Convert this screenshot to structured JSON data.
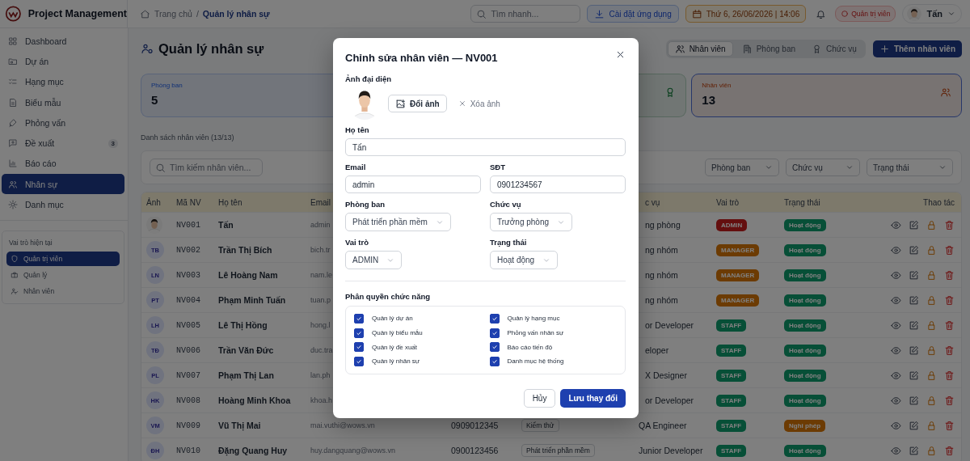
{
  "app": {
    "title": "Project Management"
  },
  "breadcrumb": {
    "separator": "/",
    "items": [
      {
        "label": "Trang chủ",
        "selected": false
      },
      {
        "label": "Quản lý nhân sự",
        "selected": true
      }
    ]
  },
  "topbar": {
    "search": {
      "placeholder": "Tìm nhanh..."
    },
    "install_button": "Cài đặt ứng dụng",
    "date": "Thứ 6, 26/06/2026 | 14:06",
    "role_badge": "Quản trị viên",
    "user": "Tấn"
  },
  "sidebar": {
    "items": [
      {
        "label": "Dashboard",
        "selected": false
      },
      {
        "label": "Dự án",
        "selected": false
      },
      {
        "label": "Hạng mục",
        "selected": false
      },
      {
        "label": "Biểu mẫu",
        "selected": false
      },
      {
        "label": "Phỏng vấn",
        "selected": false
      },
      {
        "label": "Đề xuất",
        "selected": false,
        "badge": "3"
      },
      {
        "label": "Báo cáo",
        "selected": false
      },
      {
        "label": "Nhân sự",
        "selected": true
      },
      {
        "label": "Danh mục",
        "selected": false
      }
    ],
    "role_section": {
      "title": "Vai trò hiện tại",
      "roles": [
        {
          "label": "Quản trị viên",
          "selected": true
        },
        {
          "label": "Quản lý",
          "selected": false
        },
        {
          "label": "Nhân viên",
          "selected": false
        }
      ]
    }
  },
  "page": {
    "title": "Quản lý nhân sự",
    "tabs": [
      {
        "label": "Nhân viên",
        "selected": true
      },
      {
        "label": "Phòng ban",
        "selected": false
      },
      {
        "label": "Chức vụ",
        "selected": false
      }
    ],
    "add_button": "Thêm nhân viên"
  },
  "stats": [
    {
      "label": "Phòng ban",
      "value": "5",
      "selected": false
    },
    {
      "selected": false
    },
    {
      "label": "Nhân viên",
      "value": "13",
      "selected": true
    }
  ],
  "list_title": "Danh sách nhân viên (13/13)",
  "filters": {
    "search": {
      "placeholder": "Tìm kiếm nhân viên..."
    },
    "selects": [
      "Phòng ban",
      "Chức vụ",
      "Trạng thái"
    ]
  },
  "table": {
    "columns": [
      "Ảnh",
      "Mã NV",
      "Họ tên",
      "Email",
      "c vụ",
      "Vai trò",
      "Trạng thái",
      "Thao tác"
    ],
    "rows": [
      {
        "id": "NV001",
        "name": "Tấn",
        "email": "admin",
        "position": "ng phòng",
        "role": {
          "label": "ADMIN",
          "kind": "admin"
        },
        "status": {
          "label": "Hoạt động",
          "kind": "active"
        }
      },
      {
        "avatar": {
          "kind": "initials",
          "text": "TB"
        },
        "id": "NV002",
        "name": "Trần Thị Bích",
        "email": "bich.tr",
        "position": "ng nhóm",
        "role": {
          "label": "MANAGER",
          "kind": "manager"
        },
        "status": {
          "label": "Hoạt động",
          "kind": "active"
        }
      },
      {
        "avatar": {
          "kind": "initials",
          "text": "LN"
        },
        "id": "NV003",
        "name": "Lê Hoàng Nam",
        "email": "nam.le",
        "position": "ng nhóm",
        "role": {
          "label": "MANAGER",
          "kind": "manager"
        },
        "status": {
          "label": "Hoạt động",
          "kind": "active"
        }
      },
      {
        "avatar": {
          "kind": "initials",
          "text": "PT"
        },
        "id": "NV004",
        "name": "Phạm Minh Tuấn",
        "email": "tuan.p",
        "position": "ng nhóm",
        "role": {
          "label": "MANAGER",
          "kind": "manager"
        },
        "status": {
          "label": "Hoạt động",
          "kind": "active"
        }
      },
      {
        "avatar": {
          "kind": "initials",
          "text": "LH"
        },
        "id": "NV005",
        "name": "Lê Thị Hồng",
        "email": "hong.l",
        "position": "or Developer",
        "role": {
          "label": "STAFF",
          "kind": "staff"
        },
        "status": {
          "label": "Hoạt động",
          "kind": "active"
        }
      },
      {
        "avatar": {
          "kind": "initials",
          "text": "TĐ"
        },
        "id": "NV006",
        "name": "Trần Văn Đức",
        "email": "duc.tra",
        "position": "eloper",
        "role": {
          "label": "STAFF",
          "kind": "staff"
        },
        "status": {
          "label": "Hoạt động",
          "kind": "active"
        }
      },
      {
        "avatar": {
          "kind": "initials",
          "text": "PL"
        },
        "id": "NV007",
        "name": "Phạm Thị Lan",
        "email": "lan.ph",
        "position": "X Designer",
        "role": {
          "label": "STAFF",
          "kind": "staff"
        },
        "status": {
          "label": "Hoạt động",
          "kind": "active"
        }
      },
      {
        "avatar": {
          "kind": "initials",
          "text": "HK"
        },
        "id": "NV008",
        "name": "Hoàng Minh Khoa",
        "email": "khoa.h",
        "position": "or Developer",
        "role": {
          "label": "STAFF",
          "kind": "staff"
        },
        "status": {
          "label": "Hoạt động",
          "kind": "active"
        }
      },
      {
        "avatar": {
          "kind": "initials",
          "text": "VM"
        },
        "id": "NV009",
        "name": "Vũ Thị Mai",
        "email": "mai.vuthi@wows.vn",
        "phone": "0909012345",
        "department": "Kiểm thử",
        "position": "QA Engineer",
        "role": {
          "label": "STAFF",
          "kind": "staff"
        },
        "status": {
          "label": "Nghỉ phép",
          "kind": "leave"
        }
      },
      {
        "avatar": {
          "kind": "initials",
          "text": "ĐH"
        },
        "id": "NV010",
        "name": "Đặng Quang Huy",
        "email": "huy.dangquang@wows.vn",
        "phone": "0900123456",
        "department": "Phát triển phần mềm",
        "position": "Junior Developer",
        "role": {
          "label": "STAFF",
          "kind": "staff"
        },
        "status": {
          "label": "Hoạt động",
          "kind": "active"
        }
      }
    ]
  },
  "modal": {
    "title": "Chỉnh sửa nhân viên — NV001",
    "avatar_label": "Ảnh đại diện",
    "change_photo": "Đổi ảnh",
    "remove_photo": "Xóa ảnh",
    "fields": [
      {
        "label": "Họ tên",
        "value": "Tấn",
        "kind": "text",
        "full_width": true
      },
      {
        "label": "Email",
        "value": "admin",
        "kind": "text",
        "full_width": false
      },
      {
        "label": "SĐT",
        "value": "0901234567",
        "kind": "text",
        "full_width": false
      },
      {
        "label": "Phòng ban",
        "value": "Phát triển phần mềm",
        "kind": "select",
        "full_width": false
      },
      {
        "label": "Chức vụ",
        "value": "Trưởng phòng",
        "kind": "select",
        "full_width": false
      },
      {
        "label": "Vai trò",
        "value": "ADMIN",
        "kind": "select",
        "full_width": false
      },
      {
        "label": "Trạng thái",
        "value": "Hoạt động",
        "kind": "select",
        "full_width": false
      }
    ],
    "permissions_title": "Phân quyền chức năng",
    "permissions": [
      {
        "label": "Quản lý dự án",
        "checked": true
      },
      {
        "label": "Quản lý hạng mục",
        "checked": true
      },
      {
        "label": "Quản lý biểu mẫu",
        "checked": true
      },
      {
        "label": "Phỏng vấn nhân sự",
        "checked": true
      },
      {
        "label": "Quản lý đề xuất",
        "checked": true
      },
      {
        "label": "Báo cáo tiến độ",
        "checked": true
      },
      {
        "label": "Quản lý nhân sự",
        "checked": true
      },
      {
        "label": "Danh mục hệ thống",
        "checked": true
      }
    ],
    "cancel": "Hủy",
    "save": "Lưu thay đổi"
  }
}
